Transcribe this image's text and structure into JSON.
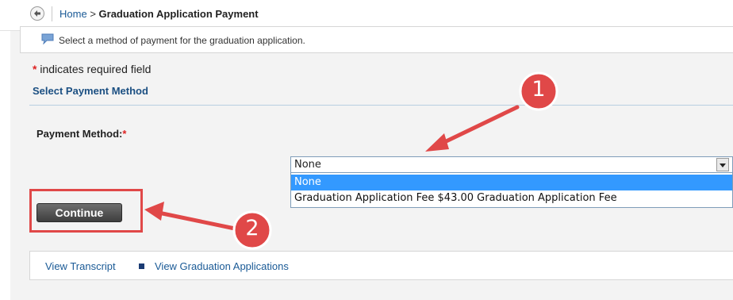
{
  "breadcrumb": {
    "home": "Home",
    "separator": ">",
    "current": "Graduation Application Payment"
  },
  "info_message": "Select a method of payment for the graduation application.",
  "required_note": {
    "star": "*",
    "text": "indicates required field"
  },
  "section_title": "Select Payment Method",
  "payment_method": {
    "label": "Payment Method:",
    "required_star": "*",
    "selected_value": "None",
    "options": [
      "None",
      "Graduation Application Fee $43.00 Graduation Application Fee"
    ]
  },
  "continue_label": "Continue",
  "footer_links": {
    "transcript": "View Transcript",
    "applications": "View Graduation Applications"
  },
  "annotations": {
    "badge1": "1",
    "badge2": "2",
    "color": "#e04848"
  },
  "icons": [
    "back-arrow-icon",
    "speech-bubble-icon",
    "dropdown-arrow-icon",
    "square-bullet-icon"
  ]
}
